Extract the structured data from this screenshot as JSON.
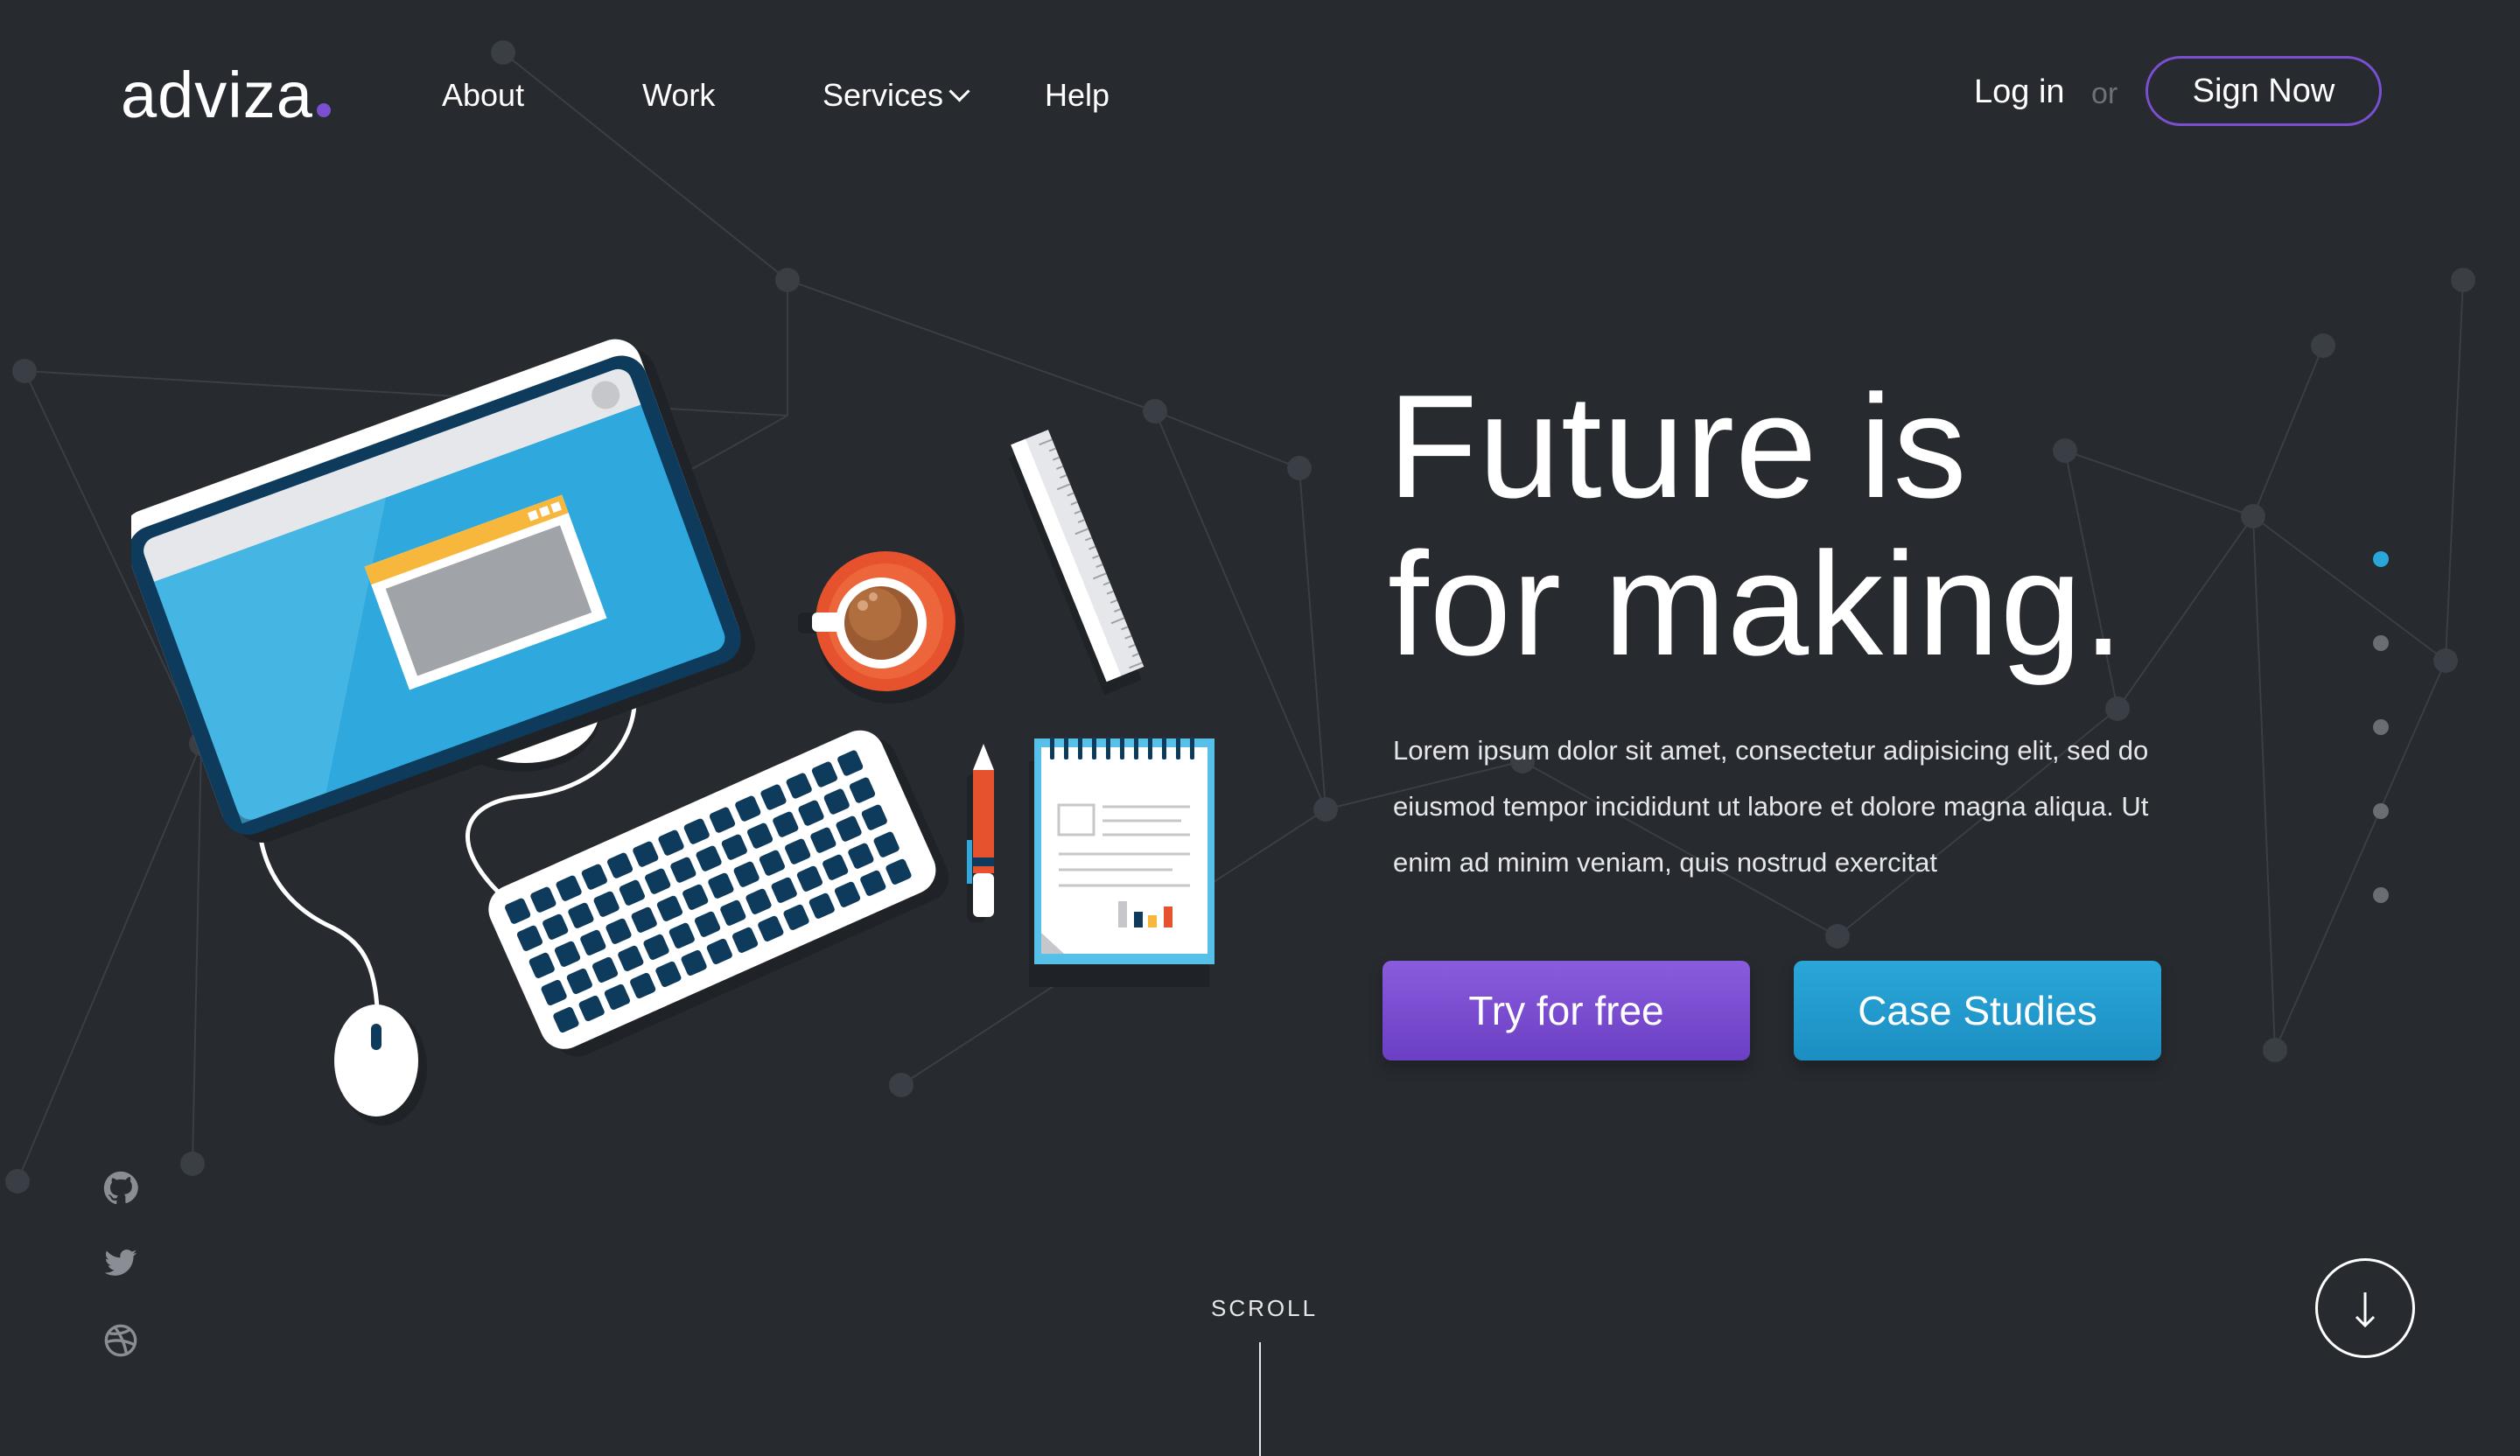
{
  "brand": {
    "name": "adviza",
    "dot_color": "#7a4fd0"
  },
  "nav": {
    "items": [
      {
        "label": "About"
      },
      {
        "label": "Work"
      },
      {
        "label": "Services"
      },
      {
        "label": "Help"
      }
    ]
  },
  "auth": {
    "login_label": "Log in",
    "or_label": "or",
    "signup_label": "Sign Now"
  },
  "hero": {
    "title_line1": "Future is",
    "title_line2": "for making.",
    "description": "Lorem ipsum dolor sit amet, consectetur adipisicing elit, sed do eiusmod tempor incididunt ut labore et dolore magna aliqua. Ut enim ad minim veniam, quis nostrud exercitat",
    "primary_cta": "Try for free",
    "secondary_cta": "Case Studies"
  },
  "pagination": {
    "count": 5,
    "active_index": 0
  },
  "social": {
    "icons": [
      "github-icon",
      "twitter-icon",
      "dribbble-icon"
    ]
  },
  "scroll": {
    "label": "SCROLL"
  },
  "colors": {
    "background": "#272a2f",
    "purple": "#7a4fd0",
    "blue": "#2aa6d8"
  }
}
